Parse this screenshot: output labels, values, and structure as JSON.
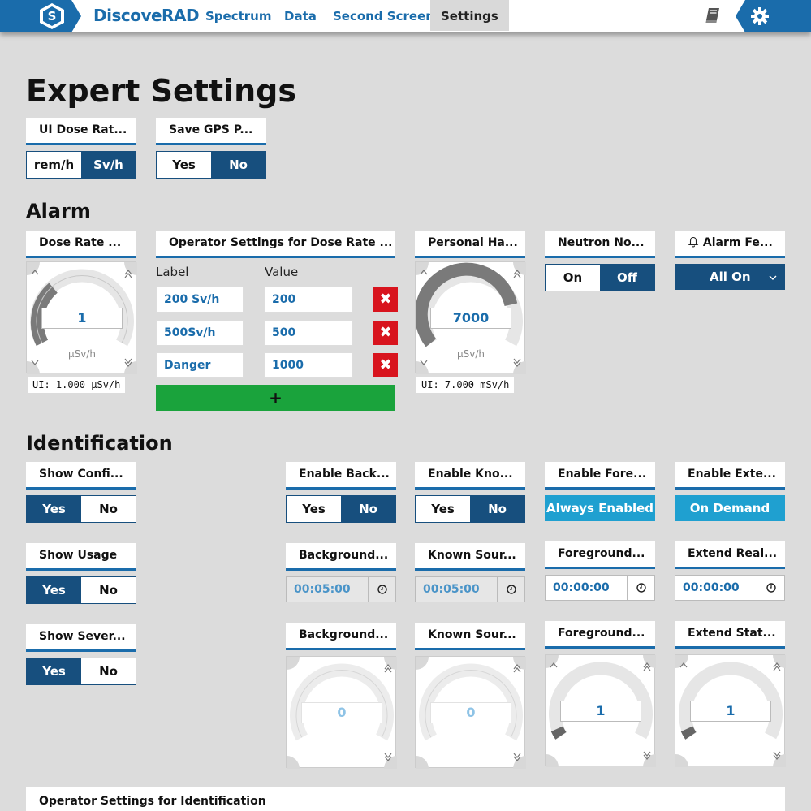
{
  "app": {
    "logo_letter": "S",
    "brand": "DiscoveRAD"
  },
  "nav": [
    "Spectrum",
    "Data",
    "Second Screen",
    "Settings"
  ],
  "page": {
    "title": "Expert Settings"
  },
  "ui_dose_rate": {
    "label": "UI Dose Rat...",
    "options": [
      "rem/h",
      "Sv/h"
    ],
    "selected": "Sv/h"
  },
  "save_gps": {
    "label": "Save GPS P...",
    "options": [
      "Yes",
      "No"
    ],
    "selected": "No"
  },
  "alarm": {
    "title": "Alarm",
    "dose_rate": {
      "label": "Dose Rate ...",
      "value": "1",
      "unit": "µSv/h",
      "info": "UI: 1.000 µSv/h"
    },
    "operator": {
      "label": "Operator Settings for Dose Rate ...",
      "col_label": "Label",
      "col_value": "Value",
      "rows": [
        {
          "label": "200 Sv/h",
          "value": "200"
        },
        {
          "label": "500Sv/h",
          "value": "500"
        },
        {
          "label": "Danger",
          "value": "1000"
        }
      ],
      "add": "+",
      "delete": "✖"
    },
    "personal": {
      "label": "Personal Ha...",
      "value": "7000",
      "unit": "µSv/h",
      "info": "UI: 7.000 mSv/h"
    },
    "neutron": {
      "label": "Neutron No...",
      "options": [
        "On",
        "Off"
      ],
      "selected": "Off"
    },
    "alarm_fe": {
      "label": "Alarm Fe...",
      "value": "All On"
    }
  },
  "identification": {
    "title": "Identification",
    "show_confi": {
      "label": "Show Confi...",
      "options": [
        "Yes",
        "No"
      ],
      "selected": "Yes"
    },
    "show_usage": {
      "label": "Show Usage",
      "options": [
        "Yes",
        "No"
      ],
      "selected": "Yes"
    },
    "show_sever": {
      "label": "Show Sever...",
      "options": [
        "Yes",
        "No"
      ],
      "selected": "Yes"
    },
    "enable_back": {
      "label": "Enable Back...",
      "options": [
        "Yes",
        "No"
      ],
      "selected": "No"
    },
    "enable_kno": {
      "label": "Enable Kno...",
      "options": [
        "Yes",
        "No"
      ],
      "selected": "No"
    },
    "enable_fore": {
      "label": "Enable Fore...",
      "value": "Always Enabled"
    },
    "enable_exte": {
      "label": "Enable Exte...",
      "value": "On Demand"
    },
    "times": [
      {
        "label": "Background...",
        "value": "00:05:00"
      },
      {
        "label": "Known Sour...",
        "value": "00:05:00"
      },
      {
        "label": "Foreground...",
        "value": "00:00:00"
      },
      {
        "label": "Extend Real...",
        "value": "00:00:00"
      }
    ],
    "gauges": [
      {
        "label": "Background...",
        "value": "0"
      },
      {
        "label": "Known Sour...",
        "value": "0"
      },
      {
        "label": "Foreground...",
        "value": "1"
      },
      {
        "label": "Extend Stat...",
        "value": "1"
      }
    ],
    "operator_label": "Operator Settings for Identification"
  },
  "colors": {
    "primary": "#1a6cab",
    "dark": "#174f7e",
    "danger": "#d8141e",
    "success": "#1aa33c",
    "cyan": "#1fa0d0"
  }
}
